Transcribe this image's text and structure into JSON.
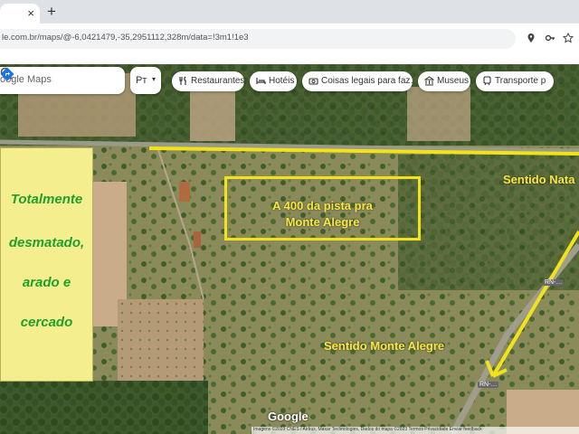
{
  "browser": {
    "tab_close": "×",
    "new_tab": "+",
    "url": "le.com.br/maps/@-6,0421479,-35,2951112,328m/data=!3m1!1e3"
  },
  "maps": {
    "search_placeholder": "oogle Maps",
    "language": "Pт",
    "chips": [
      {
        "label": "Restaurantes",
        "icon": "fork-knife-icon"
      },
      {
        "label": "Hotéis",
        "icon": "bed-icon"
      },
      {
        "label": "Coisas legais para faz…",
        "icon": "camera-icon"
      },
      {
        "label": "Museus",
        "icon": "museum-icon"
      },
      {
        "label": "Transporte p",
        "icon": "train-icon"
      }
    ],
    "logo": "Google",
    "attribution": "Imagens ©2023 CNES / Airbus, Maxar Technologies, Dados do mapa ©2023   Termos   Privacidade   Enviar feedback"
  },
  "annotations": {
    "box_line1": "A 400 da pista pra",
    "box_line2": "Monte Alegre",
    "panel_lines": [
      "Totalmente",
      "desmatado,",
      "arado e",
      "cercado"
    ],
    "sentido_natal": "Sentido Nata",
    "sentido_monte_alegre": "Sentido Monte Alegre",
    "road_badge_1": "RN-…",
    "road_badge_2": "RN-…"
  },
  "colors": {
    "annotation_yellow": "#f2e21a",
    "panel_green_text": "#1fa02a",
    "panel_bg": "#f4ee8e"
  }
}
